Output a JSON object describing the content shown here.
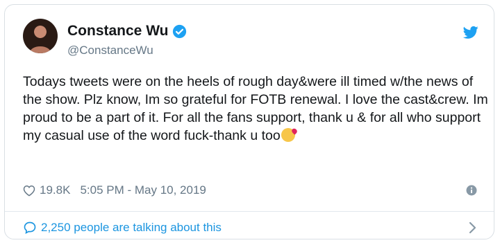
{
  "tweet": {
    "display_name": "Constance Wu",
    "handle": "@ConstanceWu",
    "verified": true,
    "text": "Todays tweets were on the heels of rough day&were ill timed w/the news of the show. Plz know, Im so grateful for FOTB renewal. I love the cast&crew. Im proud to be a part of it. For all the fans support, thank u & for all who support my casual use of the word fuck-thank u too",
    "emoji": "face-blowing-a-kiss",
    "likes": "19.8K",
    "timestamp": "5:05 PM - May 10, 2019",
    "talking_about": "2,250 people are talking about this"
  },
  "icons": {
    "verified": "verified-badge-icon",
    "logo": "twitter-bird-icon",
    "like": "heart-icon",
    "info": "info-icon",
    "conversation": "speech-bubble-icon",
    "more": "chevron-right-icon"
  },
  "colors": {
    "brand": "#1da1f2",
    "link": "#1b95e0",
    "muted": "#657786",
    "text": "#14171a"
  }
}
